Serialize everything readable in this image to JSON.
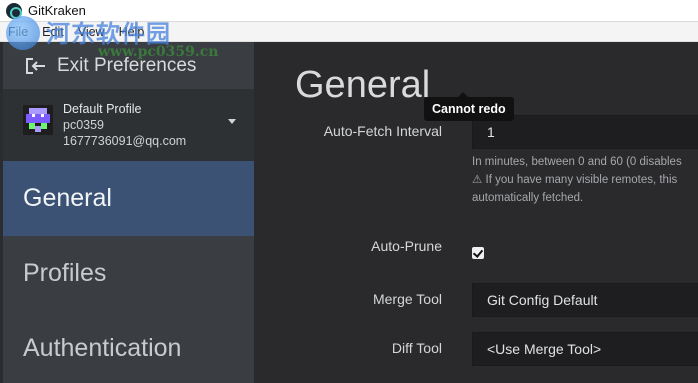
{
  "window": {
    "title": "GitKraken"
  },
  "menu": [
    "File",
    "Edit",
    "View",
    "Help"
  ],
  "watermark": {
    "text": "河东软件园",
    "url": "www.pc0359.cn"
  },
  "sidebar": {
    "exit_label": "Exit Preferences",
    "profile": {
      "name": "Default Profile",
      "username": "pc0359",
      "email": "1677736091@qq.com"
    },
    "nav": [
      {
        "label": "General",
        "active": true
      },
      {
        "label": "Profiles",
        "active": false
      },
      {
        "label": "Authentication",
        "active": false
      }
    ]
  },
  "main": {
    "title": "General",
    "tooltip": "Cannot redo",
    "auto_fetch": {
      "label": "Auto-Fetch Interval",
      "value": "1",
      "help_line1": "In minutes, between 0 and 60 (0 disables",
      "help_line2": "⚠ If you have many visible remotes, this",
      "help_line3": "automatically fetched."
    },
    "auto_prune": {
      "label": "Auto-Prune",
      "checked": true
    },
    "merge_tool": {
      "label": "Merge Tool",
      "value": "Git Config Default"
    },
    "diff_tool": {
      "label": "Diff Tool",
      "value": "<Use Merge Tool>"
    }
  },
  "colors": {
    "active_nav": "#3b5275",
    "sidebar": "#3a3e42",
    "main_bg": "#2a2a2c"
  },
  "icons": {
    "app": "gitkraken-icon",
    "exit": "exit-arrow-icon",
    "caret": "caret-down-icon",
    "checkbox": "checkbox-checked-icon"
  }
}
